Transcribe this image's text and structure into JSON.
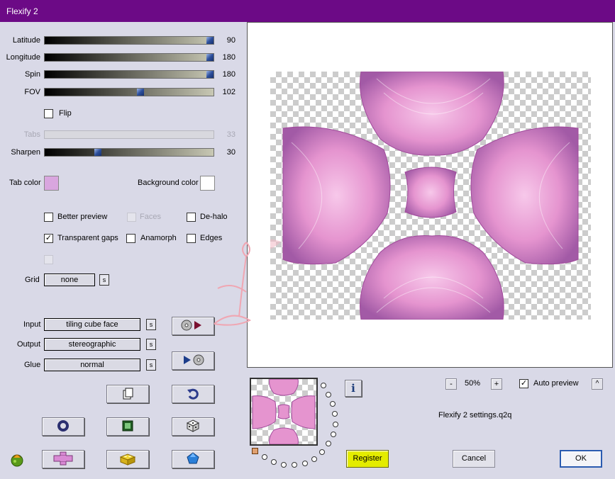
{
  "window": {
    "title": "Flexify 2"
  },
  "sliders": [
    {
      "key": "latitude",
      "label": "Latitude",
      "value": "90",
      "fraction": 0.98,
      "enabled": true
    },
    {
      "key": "longitude",
      "label": "Longitude",
      "value": "180",
      "fraction": 0.98,
      "enabled": true
    },
    {
      "key": "spin",
      "label": "Spin",
      "value": "180",
      "fraction": 0.98,
      "enabled": true
    },
    {
      "key": "fov",
      "label": "FOV",
      "value": "102",
      "fraction": 0.56,
      "enabled": true
    },
    {
      "key": "tabs",
      "label": "Tabs",
      "value": "33",
      "fraction": null,
      "enabled": false
    },
    {
      "key": "sharpen",
      "label": "Sharpen",
      "value": "30",
      "fraction": 0.31,
      "enabled": true
    }
  ],
  "flip": {
    "label": "Flip",
    "checked": false
  },
  "colors": {
    "tab_color_label": "Tab color",
    "tab_color": "#d9a6df",
    "background_color_label": "Background color",
    "background_color": "#ffffff",
    "title_bar": "#6c0a86",
    "register_button": "#e4ec00"
  },
  "options": {
    "better_preview": {
      "label": "Better preview",
      "checked": false
    },
    "faces": {
      "label": "Faces",
      "checked": false,
      "enabled": false
    },
    "de_halo": {
      "label": "De-halo",
      "checked": false
    },
    "transparent_gaps": {
      "label": "Transparent gaps",
      "checked": true
    },
    "anamorph": {
      "label": "Anamorph",
      "checked": false
    },
    "edges": {
      "label": "Edges",
      "checked": false
    }
  },
  "grid": {
    "label": "Grid",
    "value": "none",
    "s_label": "s"
  },
  "projection": {
    "input_label": "Input",
    "input_value": "tiling cube face",
    "output_label": "Output",
    "output_value": "stereographic",
    "glue_label": "Glue",
    "glue_value": "normal",
    "s_label": "s"
  },
  "zoom": {
    "minus": "-",
    "value": "50%",
    "plus": "+"
  },
  "auto_preview": {
    "label": "Auto preview",
    "checked": true,
    "button": "^"
  },
  "settings_file": "Flexify 2 settings.q2q",
  "info_icon": "i",
  "buttons": {
    "register": "Register",
    "cancel": "Cancel",
    "ok": "OK"
  },
  "icons": [
    "load-preset-icon",
    "save-preset-icon",
    "document-icon",
    "undo-icon",
    "ring-icon",
    "square-icon",
    "dice-icon",
    "cross-icon",
    "lego-brick-icon",
    "gem-icon",
    "app-logo-icon",
    "info-icon"
  ]
}
